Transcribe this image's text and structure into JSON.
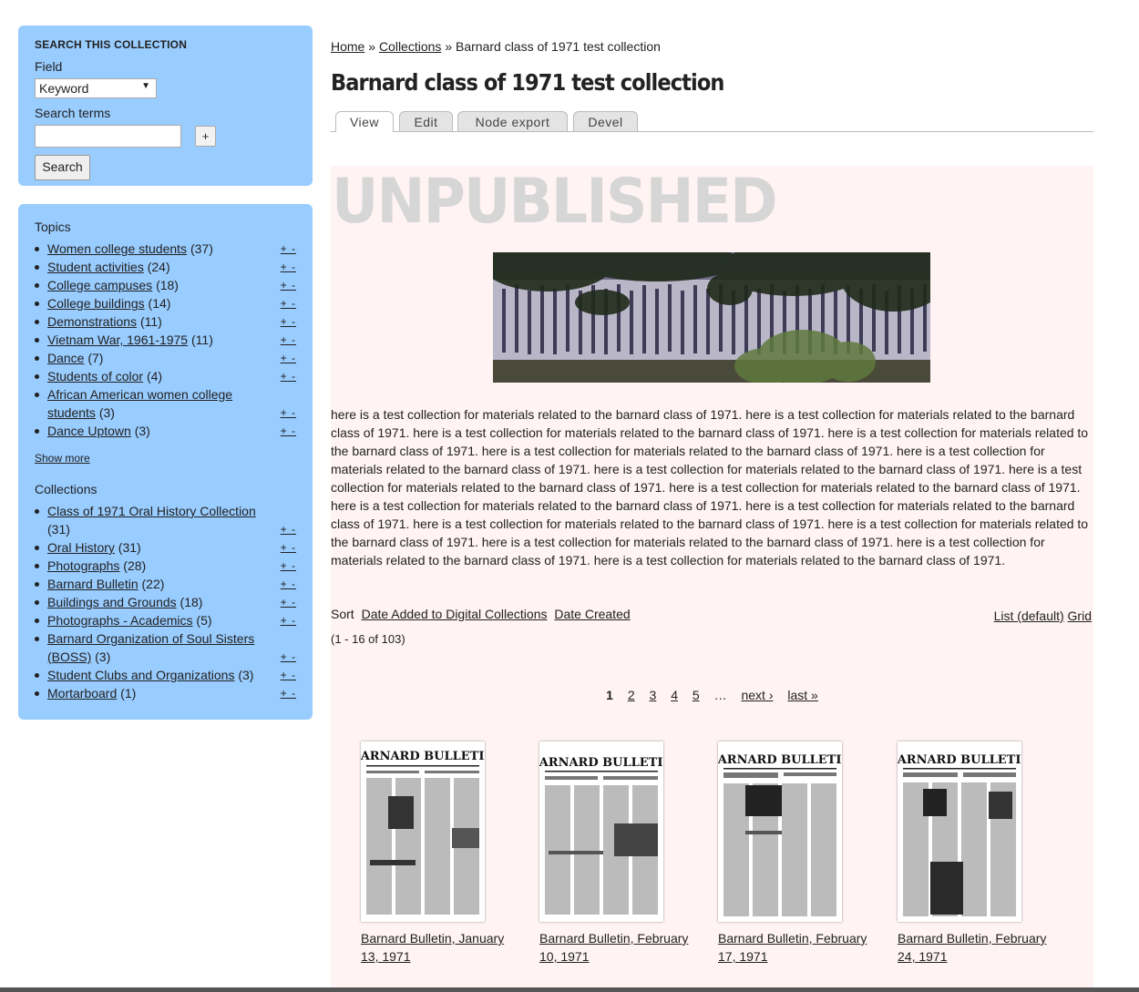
{
  "search": {
    "heading": "SEARCH THIS COLLECTION",
    "field_label": "Field",
    "field_value": "Keyword",
    "terms_label": "Search terms",
    "terms_value": "",
    "plus_label": "+",
    "button_label": "Search"
  },
  "topics": {
    "heading": "Topics",
    "items": [
      {
        "label": "Women college students",
        "count": "(37)"
      },
      {
        "label": "Student activities",
        "count": "(24)"
      },
      {
        "label": "College campuses",
        "count": "(18)"
      },
      {
        "label": "College buildings",
        "count": "(14)"
      },
      {
        "label": "Demonstrations",
        "count": "(11)"
      },
      {
        "label": "Vietnam War, 1961-1975",
        "count": "(11)"
      },
      {
        "label": "Dance",
        "count": "(7)"
      },
      {
        "label": "Students of color",
        "count": "(4)"
      },
      {
        "label": "African American women college students",
        "count": "(3)"
      },
      {
        "label": "Dance Uptown",
        "count": "(3)"
      }
    ],
    "plus_minus": "+ -",
    "show_more": "Show more"
  },
  "collections": {
    "heading": "Collections",
    "items": [
      {
        "label": "Class of 1971 Oral History Collection",
        "count": "(31)"
      },
      {
        "label": "Oral History",
        "count": "(31)"
      },
      {
        "label": "Photographs",
        "count": "(28)"
      },
      {
        "label": "Barnard Bulletin",
        "count": "(22)"
      },
      {
        "label": "Buildings and Grounds",
        "count": "(18)"
      },
      {
        "label": "Photographs - Academics",
        "count": "(5)"
      },
      {
        "label": "Barnard Organization of Soul Sisters (BOSS)",
        "count": "(3)"
      },
      {
        "label": "Student Clubs and Organizations",
        "count": "(3)"
      },
      {
        "label": "Mortarboard",
        "count": "(1)"
      }
    ]
  },
  "breadcrumb": {
    "home": "Home",
    "sep": "»",
    "collections": "Collections",
    "current": "Barnard class of 1971 test collection"
  },
  "title": "Barnard class of 1971 test collection",
  "tabs": [
    "View",
    "Edit",
    "Node export",
    "Devel"
  ],
  "unpublished": "UNPUBLISHED",
  "description": "here is a test collection for materials related to the barnard class of 1971. here is a test collection for materials related to the barnard class of 1971. here is a test collection for materials related to the barnard class of 1971. here is a test collection for materials related to the barnard class of 1971. here is a test collection for materials related to the barnard class of 1971. here is a test collection for materials related to the barnard class of 1971. here is a test collection for materials related to the barnard class of 1971. here is a test collection for materials related to the barnard class of 1971. here is a test collection for materials related to the barnard class of 1971. here is a test collection for materials related to the barnard class of 1971. here is a test collection for materials related to the barnard class of 1971. here is a test collection for materials related to the barnard class of 1971. here is a test collection for materials related to the barnard class of 1971. here is a test collection for materials related to the barnard class of 1971. here is a test collection for materials related to the barnard class of 1971. here is a test collection for materials related to the barnard class of 1971.",
  "sort": {
    "label": "Sort",
    "date_added": "Date Added to Digital Collections",
    "date_created": "Date Created"
  },
  "view_mode": {
    "list": "List (default)",
    "grid": "Grid"
  },
  "range": "(1 - 16 of 103)",
  "pager": {
    "pages": [
      "1",
      "2",
      "3",
      "4",
      "5"
    ],
    "ellipsis": "…",
    "next": "next ›",
    "last": "last »"
  },
  "results": [
    {
      "caption": "Barnard Bulletin, January 13, 1971",
      "masthead": "BARNARD BULLETIN"
    },
    {
      "caption": "Barnard Bulletin, February 10, 1971",
      "masthead": "BARNARD BULLETIN"
    },
    {
      "caption": "Barnard Bulletin, February 17, 1971",
      "masthead": "BARNARD BULLETIN"
    },
    {
      "caption": "Barnard Bulletin, February 24, 1971",
      "masthead": "BARNARD BULLETIN"
    }
  ]
}
